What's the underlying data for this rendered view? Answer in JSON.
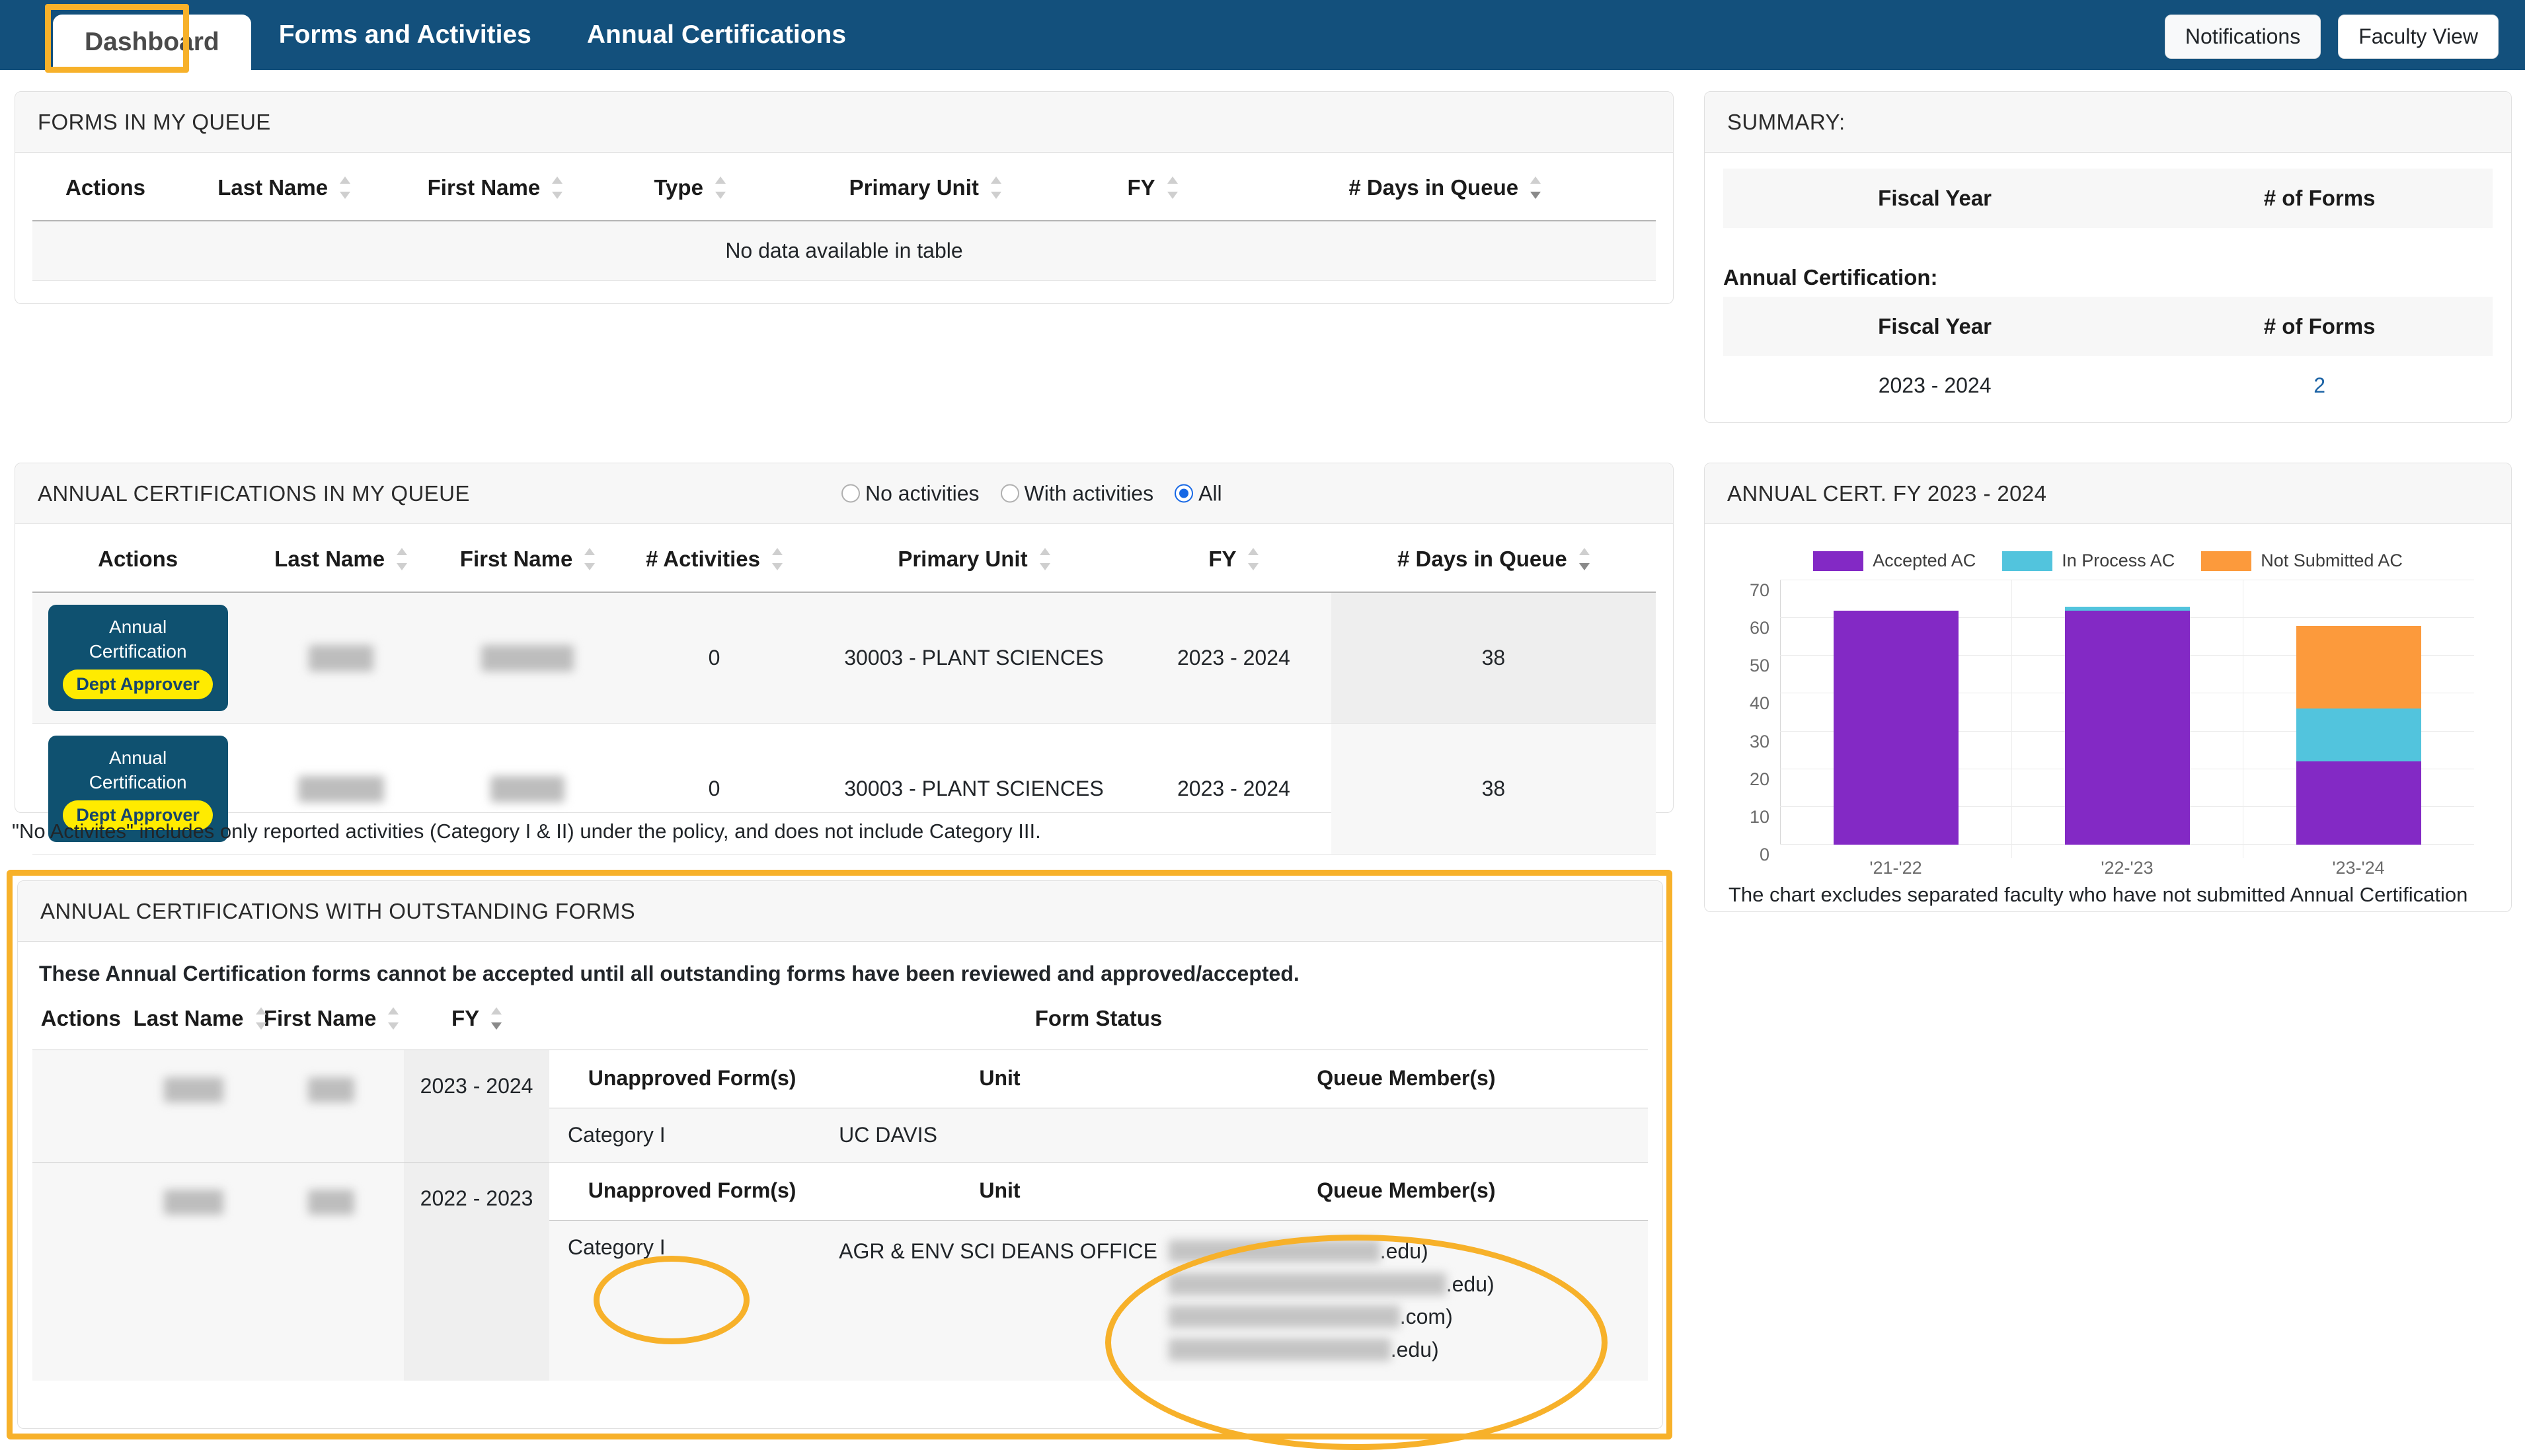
{
  "nav": {
    "tabs": [
      {
        "label": "Dashboard",
        "active": true
      },
      {
        "label": "Forms and Activities",
        "active": false
      },
      {
        "label": "Annual Certifications",
        "active": false
      }
    ],
    "notifications_label": "Notifications",
    "faculty_view_label": "Faculty View",
    "bar_color": "#13507c",
    "highlight_color": "#f7b12a"
  },
  "forms_queue": {
    "title": "FORMS IN MY QUEUE",
    "columns": [
      "Actions",
      "Last Name",
      "First Name",
      "Type",
      "Primary Unit",
      "FY",
      "# Days in Queue"
    ],
    "empty_message": "No data available in table",
    "rows": []
  },
  "summary": {
    "title": "SUMMARY:",
    "top_table": {
      "columns": [
        "Fiscal Year",
        "# of Forms"
      ],
      "rows": []
    },
    "section_label": "Annual Certification:",
    "ac_table": {
      "columns": [
        "Fiscal Year",
        "# of Forms"
      ],
      "rows": [
        {
          "fiscal_year": "2023 - 2024",
          "forms": "2"
        }
      ]
    }
  },
  "ac_queue": {
    "title": "ANNUAL CERTIFICATIONS IN MY QUEUE",
    "filters": [
      {
        "label": "No activities",
        "selected": false
      },
      {
        "label": "With activities",
        "selected": false
      },
      {
        "label": "All",
        "selected": true
      }
    ],
    "columns": [
      "Actions",
      "Last Name",
      "First Name",
      "# Activities",
      "Primary Unit",
      "FY",
      "# Days in Queue"
    ],
    "rows": [
      {
        "action_label": "Annual Certification",
        "action_badge": "Dept Approver",
        "last_name": "",
        "first_name": "",
        "activities": "0",
        "primary_unit": "30003 - PLANT SCIENCES",
        "fy": "2023 - 2024",
        "days_in_queue": "38"
      },
      {
        "action_label": "Annual Certification",
        "action_badge": "Dept Approver",
        "last_name": "",
        "first_name": "",
        "activities": "0",
        "primary_unit": "30003 - PLANT SCIENCES",
        "fy": "2023 - 2024",
        "days_in_queue": "38"
      }
    ],
    "footnote": "\"No Activites\" includes only reported activities (Category I & II) under the policy, and does not include Category III."
  },
  "chart_panel": {
    "title": "ANNUAL CERT. FY 2023 - 2024",
    "footnote": "The chart excludes separated faculty who have not submitted Annual Certification"
  },
  "chart_data": {
    "type": "bar",
    "stacked": true,
    "title": "ANNUAL CERT. FY 2023 - 2024",
    "categories": [
      "'21-'22",
      "'22-'23",
      "'23-'24"
    ],
    "series": [
      {
        "name": "Accepted AC",
        "color": "#8329c5",
        "values": [
          62,
          62,
          22
        ]
      },
      {
        "name": "In Process AC",
        "color": "#52c4dd",
        "values": [
          0,
          1,
          14
        ]
      },
      {
        "name": "Not Submitted AC",
        "color": "#fc9a3c",
        "values": [
          0,
          0,
          22
        ]
      }
    ],
    "xlabel": "",
    "ylabel": "",
    "ylim": [
      0,
      70
    ],
    "yticks": [
      0,
      10,
      20,
      30,
      40,
      50,
      60,
      70
    ],
    "grid": true,
    "legend_position": "top"
  },
  "outstanding": {
    "title": "ANNUAL CERTIFICATIONS WITH OUTSTANDING FORMS",
    "warning": "These Annual Certification forms cannot be accepted until all outstanding forms have been reviewed and approved/accepted.",
    "columns": [
      "Actions",
      "Last Name",
      "First Name",
      "FY",
      "Form Status"
    ],
    "inner_columns": [
      "Unapproved Form(s)",
      "Unit",
      "Queue Member(s)"
    ],
    "rows": [
      {
        "last_name": "",
        "first_name": "",
        "fy": "2023 - 2024",
        "forms": [
          {
            "unapproved_form": "Category I",
            "unit": "UC DAVIS",
            "queue_members": []
          }
        ]
      },
      {
        "last_name": "",
        "first_name": "",
        "fy": "2022 - 2023",
        "forms": [
          {
            "unapproved_form": "Category I",
            "unit": "AGR & ENV SCI DEANS OFFICE",
            "queue_members": [
              ".edu)",
              ".edu)",
              ".com)",
              ".edu)"
            ]
          }
        ]
      }
    ]
  }
}
